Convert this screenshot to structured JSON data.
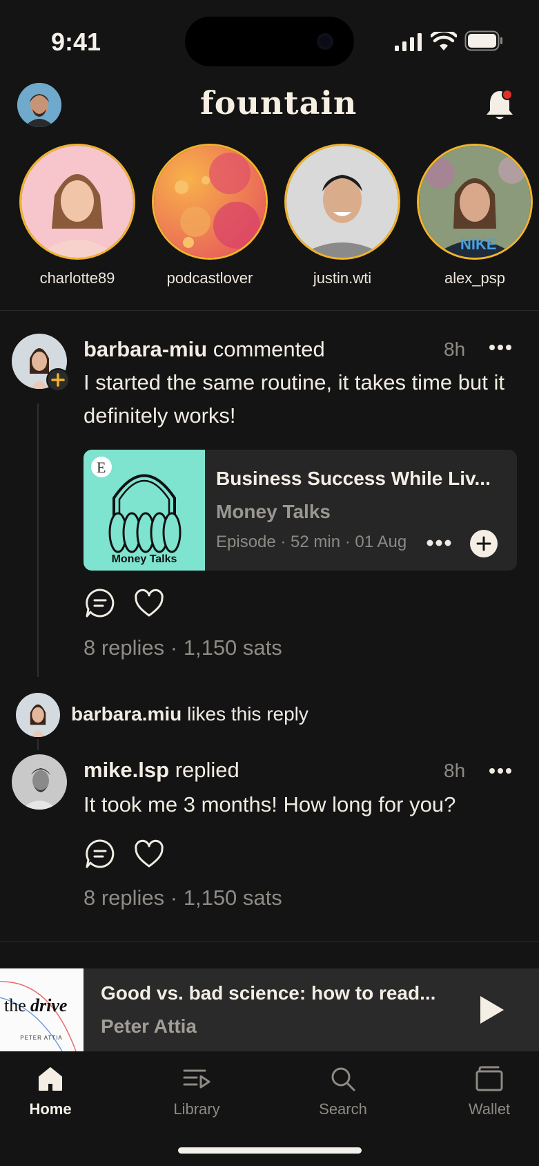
{
  "status_bar": {
    "time": "9:41"
  },
  "header": {
    "logo": "fountain",
    "profile_icon": "avatar",
    "notification_icon": "bell-icon"
  },
  "stories": [
    {
      "name": "charlotte89"
    },
    {
      "name": "podcastlover"
    },
    {
      "name": "justin.wti"
    },
    {
      "name": "alex_psp"
    }
  ],
  "post1": {
    "user": "barbara-miu",
    "action": "commented",
    "time": "8h",
    "text": "I started the same routine, it takes time but it definitely works!",
    "episode": {
      "title": "Business Success While Liv...",
      "show": "Money Talks",
      "meta": "Episode · 52 min · 01 Aug",
      "art_label": "Money Talks",
      "art_badge": "E"
    },
    "stats": "8 replies · 1,150 sats"
  },
  "like_notice": {
    "user": "barbara.miu",
    "text": "likes this reply"
  },
  "post2": {
    "user": "mike.lsp",
    "action": "replied",
    "time": "8h",
    "text": "It took me 3 months! How long for you?",
    "stats": "8 replies · 1,150 sats"
  },
  "now_playing": {
    "title": "Good vs. bad science: how to read...",
    "show": "Peter Attia",
    "art_text_1": "the",
    "art_text_2": "drive",
    "art_sub": "PETER ATTIA"
  },
  "tabs": [
    {
      "label": "Home",
      "active": true
    },
    {
      "label": "Library",
      "active": false
    },
    {
      "label": "Search",
      "active": false
    },
    {
      "label": "Wallet",
      "active": false
    }
  ],
  "colors": {
    "background": "#141414",
    "accent": "#f2b32b",
    "notification_dot": "#e0302c",
    "episode_art": "#7ee3cf"
  }
}
